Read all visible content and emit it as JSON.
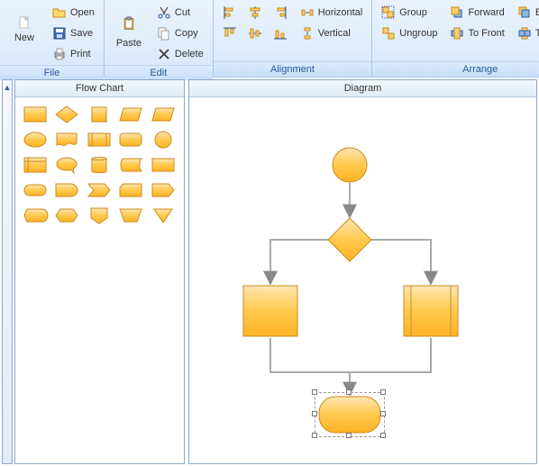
{
  "ribbon": {
    "file": {
      "label": "File",
      "new": "New",
      "open": "Open",
      "save": "Save",
      "print": "Print"
    },
    "edit": {
      "label": "Edit",
      "paste": "Paste",
      "cut": "Cut",
      "copy": "Copy",
      "delete": "Delete"
    },
    "alignment": {
      "label": "Alignment",
      "horizontal": "Horizontal",
      "vertical": "Vertical"
    },
    "arrange": {
      "label": "Arrange",
      "group": "Group",
      "ungroup": "Ungroup",
      "forward": "Forward",
      "tofront": "To Front",
      "backward": "Backward",
      "toback": "To Back"
    }
  },
  "side": {
    "title": "Flow Chart",
    "collapse": "▲"
  },
  "diagram": {
    "title": "Diagram"
  }
}
